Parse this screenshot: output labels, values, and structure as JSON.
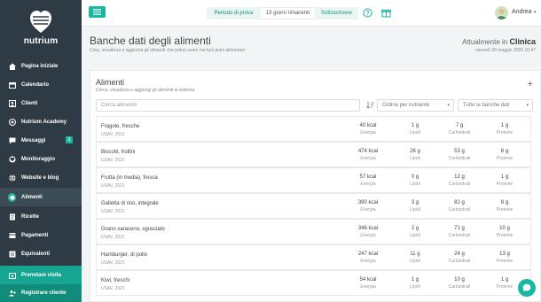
{
  "brand": {
    "name": "nutrium"
  },
  "sidebar": {
    "items": [
      {
        "label": "Pagina iniziale",
        "icon": "home-icon"
      },
      {
        "label": "Calendario",
        "icon": "calendar-icon"
      },
      {
        "label": "Clienti",
        "icon": "user-icon"
      },
      {
        "label": "Nutrium Academy",
        "icon": "academy-icon"
      },
      {
        "label": "Messaggi",
        "icon": "chat-icon",
        "badge": "1"
      },
      {
        "label": "Monitoraggio",
        "icon": "heart-icon"
      },
      {
        "label": "Website e blog",
        "icon": "globe-icon"
      },
      {
        "label": "Alimenti",
        "icon": "apple-icon",
        "active": true
      },
      {
        "label": "Ricette",
        "icon": "recipe-icon"
      },
      {
        "label": "Pagamenti",
        "icon": "payments-icon"
      },
      {
        "label": "Equivalenti",
        "icon": "equivalents-icon"
      }
    ],
    "cta": [
      {
        "label": "Prenotare visita",
        "icon": "calendar-plus-icon"
      },
      {
        "label": "Registrare cliente",
        "icon": "user-plus-icon"
      }
    ]
  },
  "topbar": {
    "trial_label": "Periodo di prova",
    "days_label": "13 giorni rimanenti",
    "subscribe_label": "Sottoscrivere",
    "user_name": "Andrea"
  },
  "page": {
    "title": "Banche dati degli alimenti",
    "subtitle": "Crea, visualizza e aggiorna gli alimenti che potrai usare nei tuoi piani alimentari",
    "now_prefix": "Attualmente in",
    "now_place": "Clinica",
    "now_date": "venerdì 30 maggio 2025 10:47"
  },
  "foods": {
    "title": "Alimenti",
    "subtitle": "Cerca, visualizza e aggiungi gli alimenti al sistema",
    "search_placeholder": "Cerca alimento",
    "sort_placeholder": "Ordina per nutriente",
    "db_select": "Tutte le banche dati",
    "columns": [
      "Energia",
      "Lipidi",
      "Carboidrati",
      "Proteine"
    ],
    "rows": [
      {
        "name": "Fragole, fresche",
        "source": "USAV, 2021",
        "energy": "40 kcal",
        "fat": "1 g",
        "carbs": "7 g",
        "protein": "1 g"
      },
      {
        "name": "Biscotti, frollini",
        "source": "USAV, 2021",
        "energy": "474 kcal",
        "fat": "26 g",
        "carbs": "53 g",
        "protein": "6 g"
      },
      {
        "name": "Frutta (in media), fresca",
        "source": "USAV, 2021",
        "energy": "57 kcal",
        "fat": "0 g",
        "carbs": "12 g",
        "protein": "1 g"
      },
      {
        "name": "Galletta di riso, integrale",
        "source": "USAV, 2021",
        "energy": "390 kcal",
        "fat": "3 g",
        "carbs": "82 g",
        "protein": "8 g"
      },
      {
        "name": "Grano saraceno, sgusciato",
        "source": "USAV, 2021",
        "energy": "346 kcal",
        "fat": "2 g",
        "carbs": "71 g",
        "protein": "10 g"
      },
      {
        "name": "Hamburger, di pollo",
        "source": "USAV, 2021",
        "energy": "247 kcal",
        "fat": "11 g",
        "carbs": "24 g",
        "protein": "13 g"
      },
      {
        "name": "Kiwi, freschi",
        "source": "USAV, 2021",
        "energy": "54 kcal",
        "fat": "1 g",
        "carbs": "10 g",
        "protein": "1 g"
      }
    ]
  },
  "colors": {
    "accent": "#19b8a0",
    "sidebar": "#2e3b44"
  }
}
